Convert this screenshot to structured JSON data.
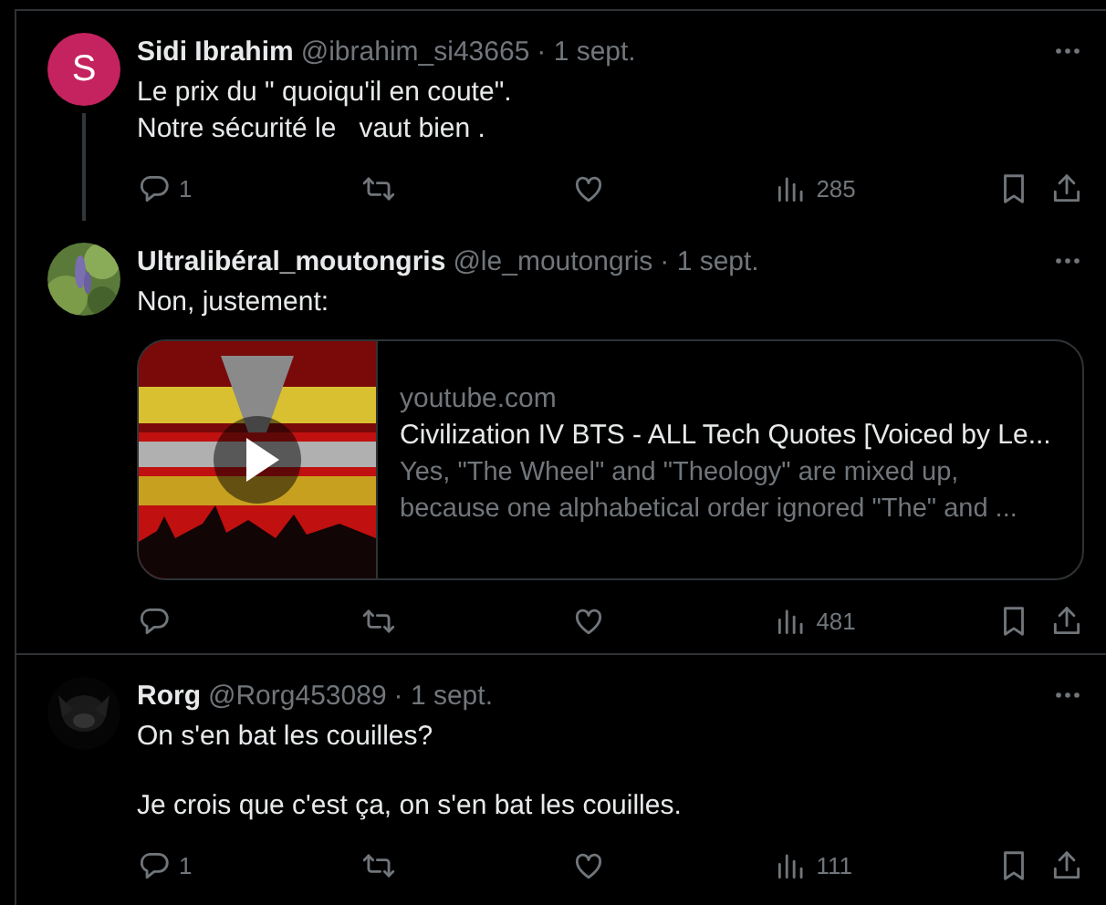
{
  "tweets": [
    {
      "avatar": {
        "kind": "letter",
        "letter": "S",
        "color": "#c4235f"
      },
      "name": "Sidi Ibrahim",
      "handle": "@ibrahim_si43665",
      "date": "· 1 sept.",
      "thread_line": true,
      "paragraphs": [
        "Le prix du \" quoiqu'il en coute\".\nNotre sécurité le   vaut bien ."
      ],
      "replies": "1",
      "views": "285"
    },
    {
      "avatar": {
        "kind": "picture"
      },
      "name": "Ultralibéral_moutongris",
      "handle": "@le_moutongris",
      "date": "· 1 sept.",
      "paragraphs": [
        "Non, justement:"
      ],
      "card": {
        "domain": "youtube.com",
        "title": "Civilization IV BTS - ALL Tech Quotes [Voiced by Le...",
        "description": "Yes, \"The Wheel\" and \"Theology\" are mixed up, because one alphabetical order ignored \"The\" and ..."
      },
      "views": "481"
    },
    {
      "avatar": {
        "kind": "picture"
      },
      "name": "Rorg",
      "handle": "@Rorg453089",
      "date": "· 1 sept.",
      "paragraphs": [
        "On s'en bat les couilles?",
        "Je crois que c'est ça, on s'en bat les couilles."
      ],
      "replies": "1",
      "views": "111"
    }
  ]
}
